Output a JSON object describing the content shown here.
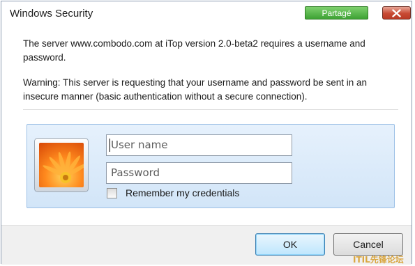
{
  "window": {
    "title": "Windows Security",
    "share_badge": "Partagé"
  },
  "message": {
    "line1": "The server www.combodo.com at iTop version 2.0-beta2 requires a username and password.",
    "warning": "Warning: This server is requesting that your username and password be sent in an insecure manner (basic authentication without a secure connection)."
  },
  "credentials": {
    "username_placeholder": "User name",
    "password_placeholder": "Password",
    "remember_label": "Remember my credentials",
    "remember_checked": false
  },
  "buttons": {
    "ok": "OK",
    "cancel": "Cancel"
  },
  "watermark": "ITIL先锋论坛",
  "colors": {
    "panel": "#dbeaf9",
    "share_badge": "#4fb244",
    "close": "#c84a34"
  }
}
